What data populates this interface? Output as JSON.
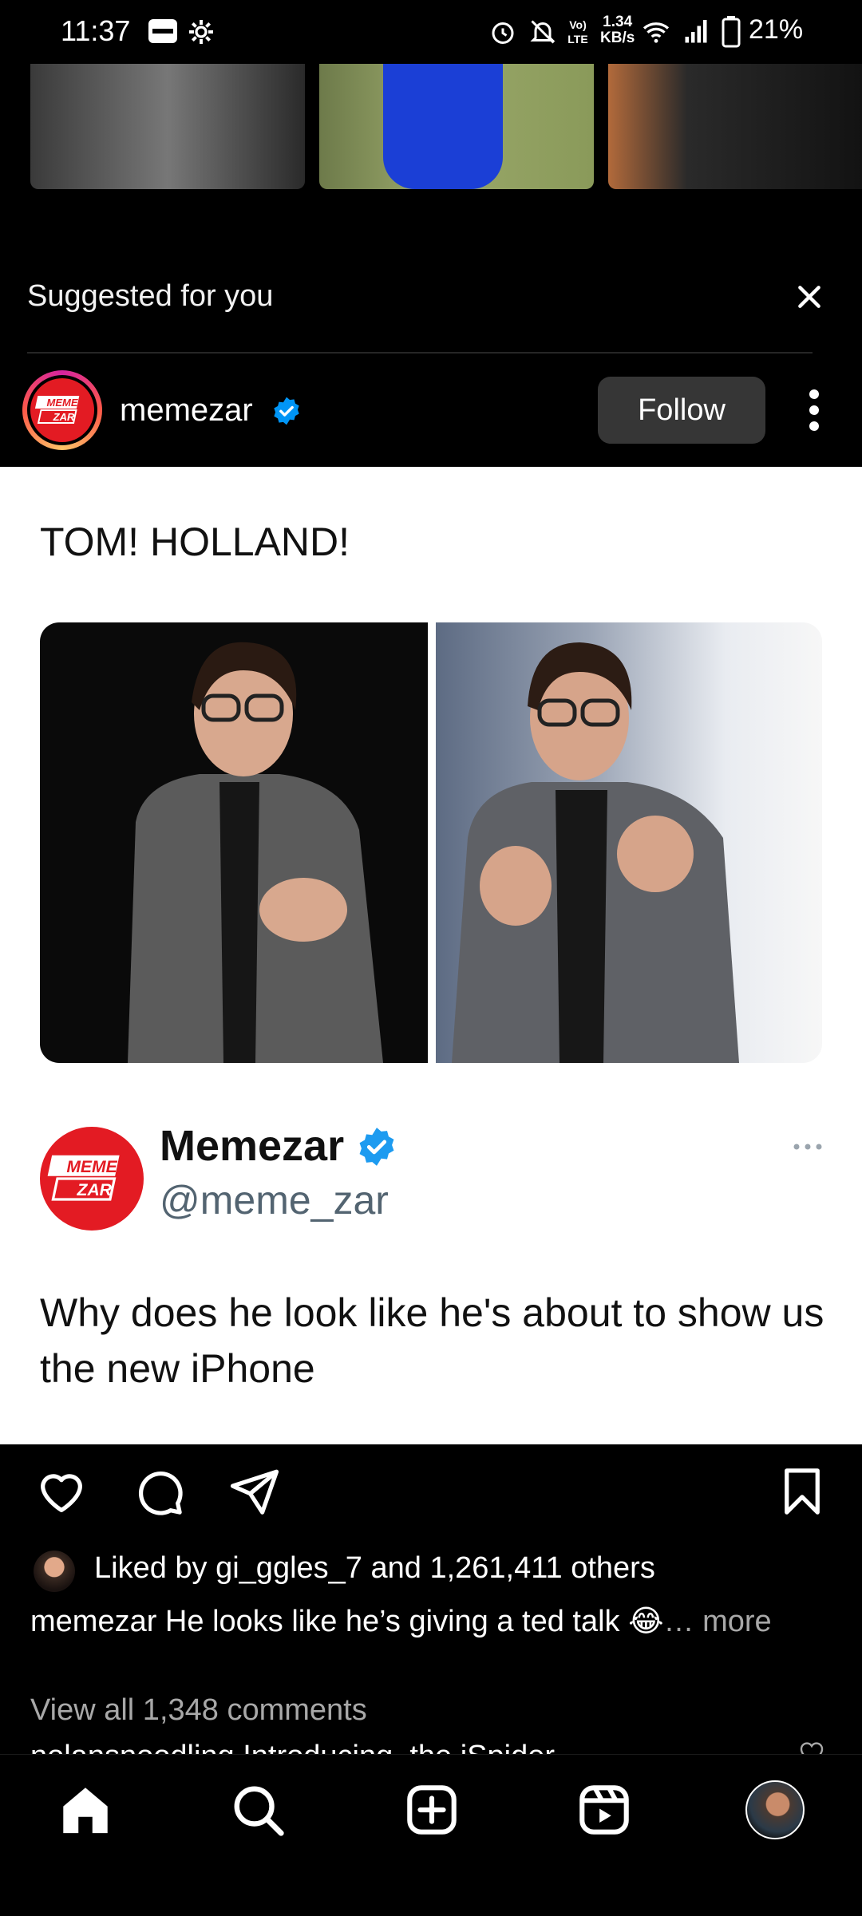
{
  "status_bar": {
    "time": "11:37",
    "network_type": "LTE",
    "net_speed_value": "1.34",
    "net_speed_unit": "KB/s",
    "battery": "21%"
  },
  "suggested": {
    "label": "Suggested for you",
    "account": {
      "username": "memezar",
      "verified": true,
      "follow_label": "Follow"
    }
  },
  "post": {
    "title": "TOM! HOLLAND!",
    "embedded_tweet": {
      "display_name": "Memezar",
      "handle": "@meme_zar",
      "text": "Why does he look like he's about to show us the new iPhone"
    },
    "logo_text": [
      "MEME",
      "ZAR"
    ]
  },
  "engagement": {
    "liked_by_prefix": "Liked by ",
    "liked_by_user": "gi_ggles_7",
    "liked_by_suffix": " and 1,261,411 others",
    "caption_user": "memezar",
    "caption_text": " He looks like he’s giving a ted talk 😂",
    "caption_more": "… more",
    "view_comments": "View all 1,348 comments",
    "next_comment": "nolansnoodling Introducing, the iSpider"
  },
  "nav": {
    "items": [
      "home",
      "search",
      "create",
      "reels",
      "profile"
    ]
  },
  "colors": {
    "background": "#000000",
    "card": "#ffffff",
    "follow_button": "#363636",
    "verified_blue": "#0095f6",
    "brand_red": "#e31b23"
  }
}
